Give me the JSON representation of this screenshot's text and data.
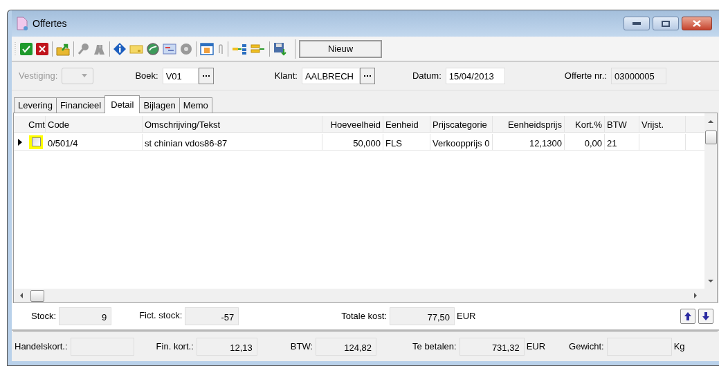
{
  "window": {
    "title": "Offertes"
  },
  "toolbar": {
    "button": "Nieuw"
  },
  "header_fields": [
    {
      "kind": "dropdown",
      "label": "Vestiging:",
      "disabled": true
    },
    {
      "kind": "lookup",
      "label": "Boek:",
      "value": "V01"
    },
    {
      "kind": "lookup",
      "label": "Klant:",
      "value": "AALBRECH"
    },
    {
      "kind": "text",
      "label": "Datum:",
      "value": "15/04/2013"
    },
    {
      "kind": "readonly",
      "label": "Offerte nr.:",
      "value": "03000005"
    }
  ],
  "tabs": [
    {
      "label": "Levering",
      "selected": false
    },
    {
      "label": "Financieel",
      "selected": false
    },
    {
      "label": "Detail",
      "selected": true
    },
    {
      "label": "Bijlagen",
      "selected": false
    },
    {
      "label": "Memo",
      "selected": false
    }
  ],
  "table": {
    "columns": [
      {
        "label": "Cmt"
      },
      {
        "label": "Code"
      },
      {
        "label": "Omschrijving/Tekst"
      },
      {
        "label": "Hoeveelheid"
      },
      {
        "label": "Eenheid"
      },
      {
        "label": "Prijscategorie"
      },
      {
        "label": "Eenheidsprijs"
      },
      {
        "label": "Kort.%"
      },
      {
        "label": "BTW"
      },
      {
        "label": "Vrijst."
      }
    ],
    "rows": [
      {
        "current": true,
        "cmt_checked": false,
        "cells": [
          "",
          "0/501/4",
          "st chinian vdos86-87",
          "50,000",
          "FLS",
          "Verkoopprijs 0",
          "12,1300",
          "0,00",
          "21",
          ""
        ]
      }
    ]
  },
  "stock_row": [
    {
      "label": "Stock:",
      "value": "9"
    },
    {
      "label": "Fict. stock:",
      "value": "-57"
    },
    {
      "label": "Totale kost:",
      "value": "77,50",
      "unit": "EUR"
    }
  ],
  "totals_bar": [
    {
      "label": "Handelskort.:"
    },
    {
      "label": "Fin. kort.:",
      "value": "12,13"
    },
    {
      "label": "BTW:",
      "value": "124,82"
    },
    {
      "label": "Te betalen:",
      "value": "731,32",
      "unit": "EUR"
    },
    {
      "label": "Gewicht:",
      "unit": "Kg"
    }
  ]
}
